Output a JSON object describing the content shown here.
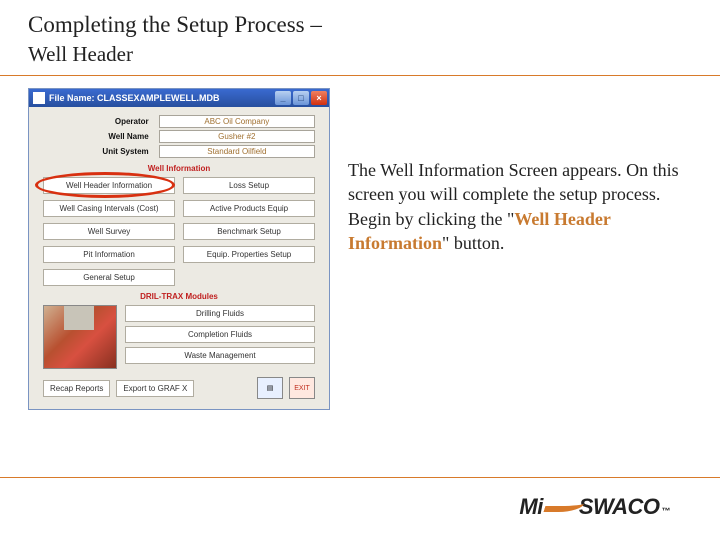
{
  "slide": {
    "title": "Completing the Setup Process –",
    "subtitle": "Well Header"
  },
  "window": {
    "titlebar_prefix": "File Name:",
    "filename": "CLASSEXAMPLEWELL.MDB",
    "header": {
      "operator_label": "Operator",
      "operator_value": "ABC Oil Company",
      "wellname_label": "Well Name",
      "wellname_value": "Gusher #2",
      "unitsystem_label": "Unit System",
      "unitsystem_value": "Standard Oilfield"
    },
    "wellinfo_header": "Well Information",
    "buttons": {
      "well_header_info": "Well Header Information",
      "loss_setup": "Loss Setup",
      "casing_intervals": "Well Casing Intervals (Cost)",
      "active_products": "Active Products Equip",
      "well_survey": "Well Survey",
      "benchmark_setup": "Benchmark Setup",
      "pit_info": "Pit Information",
      "equip_properties": "Equip. Properties Setup",
      "general_setup": "General Setup"
    },
    "modules_header": "DRIL-TRAX Modules",
    "modules": {
      "drilling_fluids": "Drilling Fluids",
      "completion_fluids": "Completion Fluids",
      "waste_management": "Waste Management"
    },
    "bottom": {
      "recap_reports": "Recap Reports",
      "export_grafx": "Export to GRAF X"
    }
  },
  "body": {
    "p1a": "The Well Information Screen appears. On this screen you will complete the setup process. Begin by clicking the \"",
    "p1_accent": "Well Header Information",
    "p1b": "\" button."
  },
  "logo": {
    "part1": "Mi",
    "part2": "SWACO",
    "tm": "™"
  }
}
